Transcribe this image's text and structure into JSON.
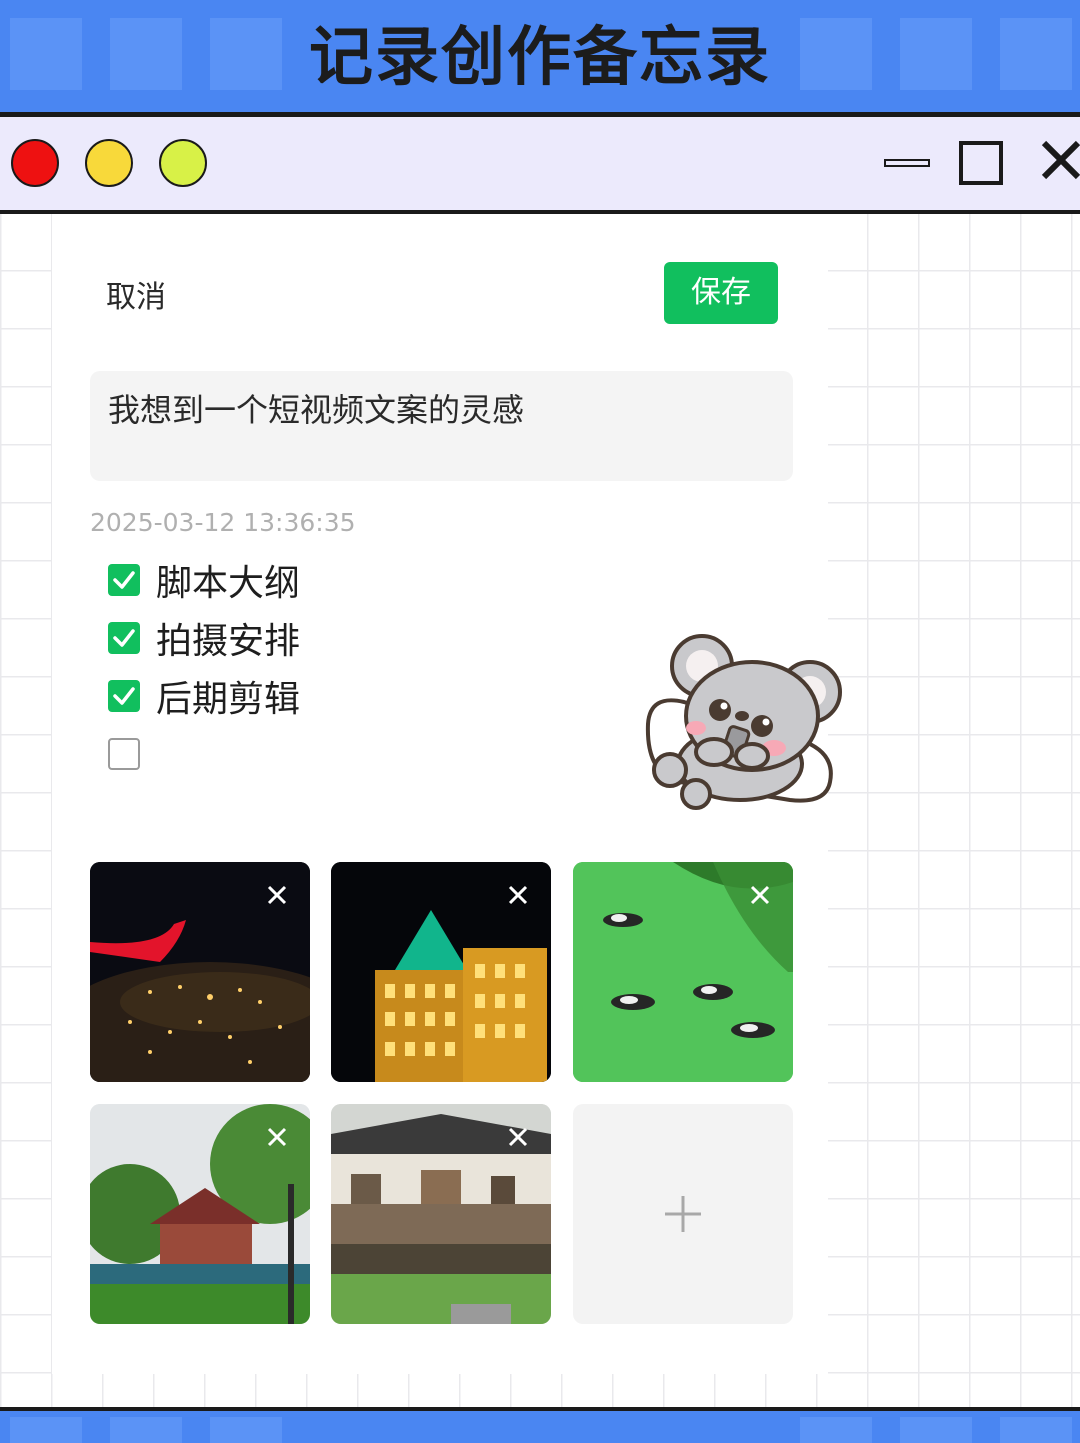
{
  "banner": {
    "title": "记录创作备忘录"
  },
  "window": {
    "controls": [
      "close-dot",
      "minimize-dot",
      "zoom-dot",
      "minimize-button",
      "maximize-button",
      "close-button"
    ]
  },
  "memo": {
    "cancel_label": "取消",
    "save_label": "保存",
    "title_text": "我想到一个短视频文案的灵感",
    "timestamp": "2025-03-12 13:36:35",
    "checklist": [
      {
        "label": "脚本大纲",
        "checked": true
      },
      {
        "label": "拍摄安排",
        "checked": true
      },
      {
        "label": "后期剪辑",
        "checked": true
      },
      {
        "label": "",
        "checked": false
      }
    ],
    "photos": [
      {
        "name": "night-flight-city-photo"
      },
      {
        "name": "illuminated-building-photo"
      },
      {
        "name": "ducks-green-pond-photo"
      },
      {
        "name": "pavilion-trees-photo"
      },
      {
        "name": "canal-houses-photo"
      }
    ],
    "add_photo_icon": "plus-icon"
  },
  "colors": {
    "banner": "#4a86f2",
    "titlebar": "#eceafc",
    "save_button": "#11bf5e",
    "checkbox_checked": "#11bf5e"
  }
}
